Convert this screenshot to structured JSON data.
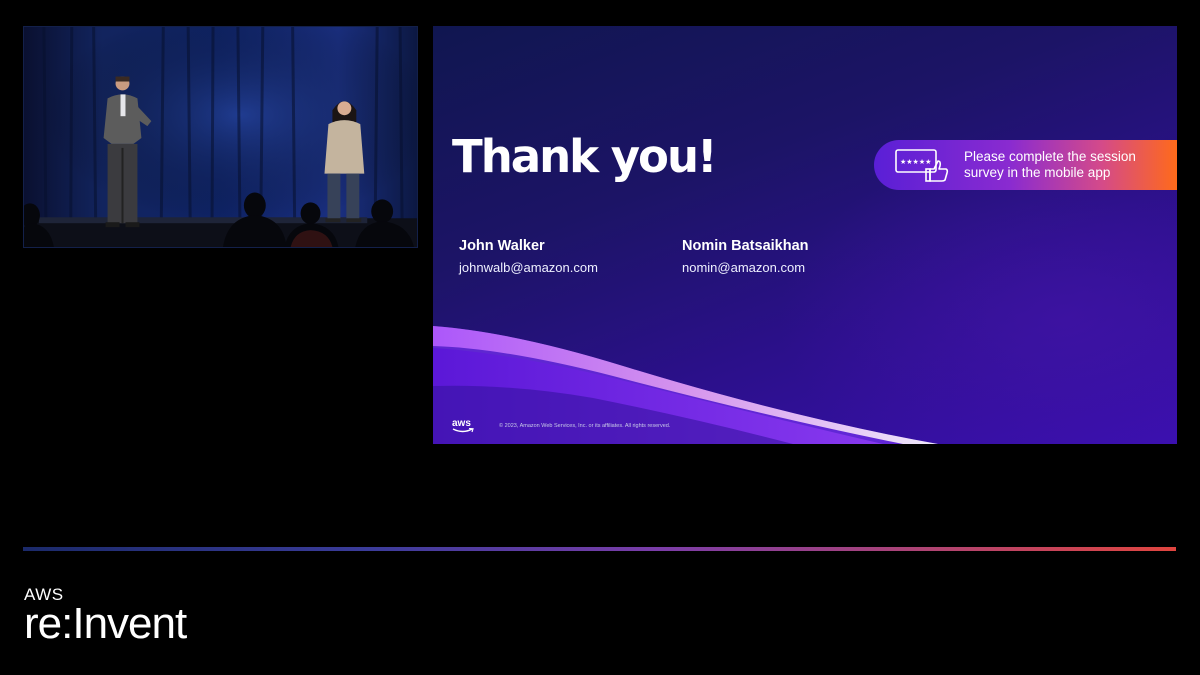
{
  "slide": {
    "title": "Thank you!",
    "survey_text": "Please complete the session survey in the mobile app",
    "presenters": [
      {
        "name": "John Walker",
        "email": "johnwalb@amazon.com"
      },
      {
        "name": "Nomin Batsaikhan",
        "email": "nomin@amazon.com"
      }
    ],
    "footer_logo": "aws",
    "copyright": "© 2023, Amazon Web Services, Inc. or its affiliates. All rights reserved."
  },
  "brand": {
    "line1": "AWS",
    "line2": "re:Invent"
  },
  "icons": {
    "survey": "rating-stars-thumbs-up-icon",
    "camera": "camera-feed-video"
  },
  "colors": {
    "background": "#000000",
    "slide_gradient_start": "#101650",
    "slide_gradient_end": "#3a0fb0",
    "survey_gradient_start": "#5a1fd6",
    "survey_gradient_end": "#ff6a1a",
    "divider_start": "#1b2a6a",
    "divider_end": "#e0453f"
  }
}
